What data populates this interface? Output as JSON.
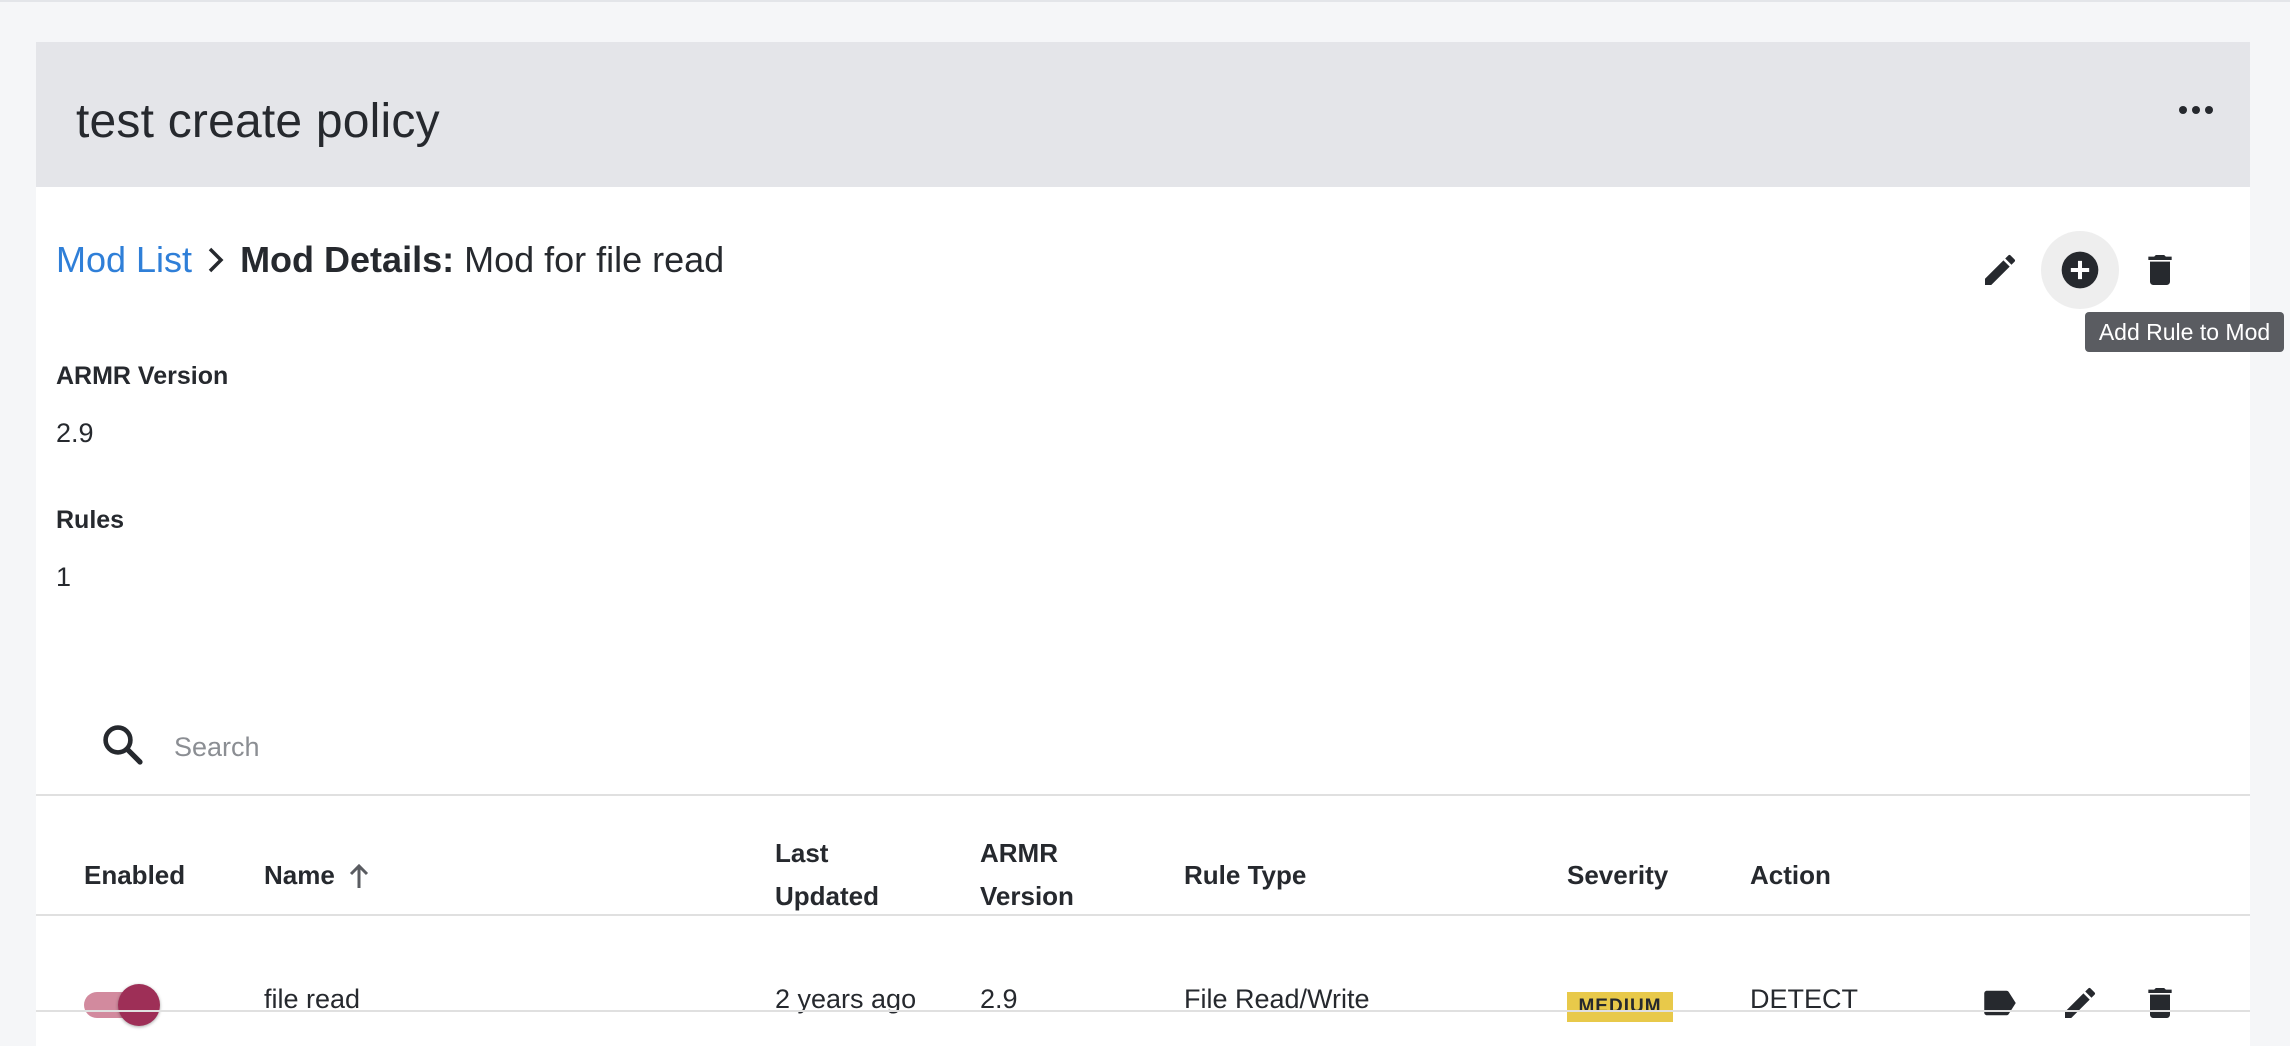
{
  "header": {
    "policy_title": "test create policy",
    "more_icon": "more-horizontal-icon"
  },
  "breadcrumb": {
    "parent": "Mod List",
    "current_label": "Mod Details:",
    "current_value": "Mod for file read",
    "separator_icon": "chevron-right-icon"
  },
  "actions": {
    "edit_icon": "pencil-icon",
    "add_icon": "plus-circle-icon",
    "delete_icon": "trash-icon",
    "tooltip": "Add Rule to Mod"
  },
  "details": {
    "armr_label": "ARMR Version",
    "armr_value": "2.9",
    "rules_label": "Rules",
    "rules_value": "1"
  },
  "search": {
    "placeholder": "Search",
    "value": "",
    "icon": "search-icon"
  },
  "table": {
    "columns": {
      "enabled": "Enabled",
      "name": "Name",
      "last_updated_1": "Last",
      "last_updated_2": "Updated",
      "armr_1": "ARMR",
      "armr_2": "Version",
      "rule_type": "Rule Type",
      "severity": "Severity",
      "action": "Action"
    },
    "sort_icon": "arrow-up-icon",
    "rows": [
      {
        "enabled": true,
        "name": "file read",
        "last_updated": "2 years ago",
        "armr_version": "2.9",
        "rule_type": "File Read/Write",
        "severity": "MEDIUM",
        "action": "DETECT",
        "row_icons": [
          "tag-icon",
          "pencil-icon",
          "trash-icon"
        ]
      }
    ]
  },
  "colors": {
    "link": "#2f7fd8",
    "header_bg": "#e4e5e9",
    "badge_medium": "#e8c94a",
    "toggle_on": "#9e2f57",
    "toggle_track": "#d28a9e",
    "tooltip_bg": "#5a5c61"
  }
}
